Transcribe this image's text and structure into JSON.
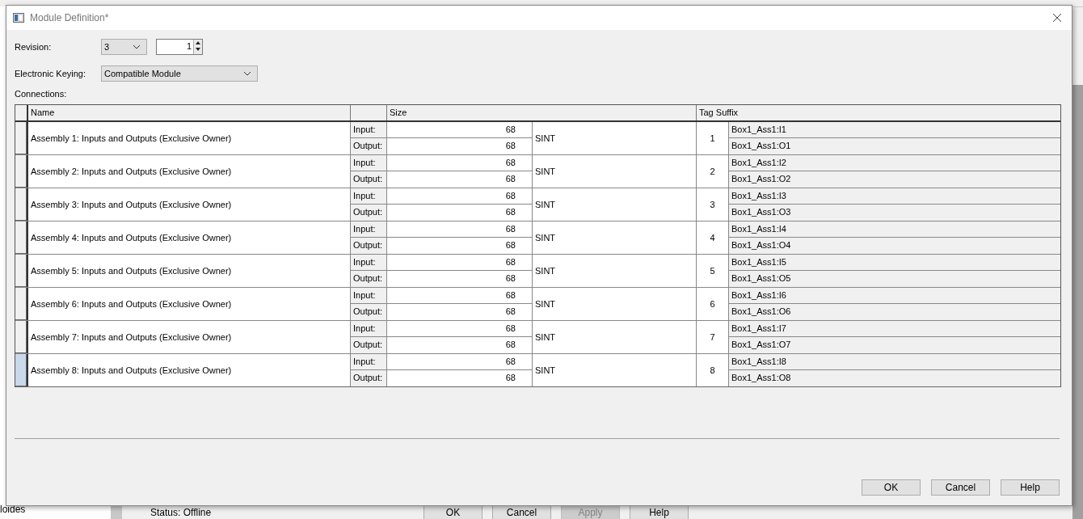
{
  "background": {
    "left_text": "loides",
    "status": "Status:  Offline",
    "buttons": [
      {
        "label": "OK",
        "disabled": false
      },
      {
        "label": "Cancel",
        "disabled": false
      },
      {
        "label": "Apply",
        "disabled": true
      },
      {
        "label": "Help",
        "disabled": false
      }
    ]
  },
  "window": {
    "title": "Module Definition*"
  },
  "revision": {
    "label": "Revision:",
    "major": "3",
    "minor": "1"
  },
  "keying": {
    "label": "Electronic Keying:",
    "value": "Compatible Module"
  },
  "connections_label": "Connections:",
  "table": {
    "columns": [
      "Name",
      "Size",
      "Tag Suffix"
    ],
    "rows": [
      {
        "name": "Assembly 1: Inputs and Outputs (Exclusive Owner)",
        "selected": false,
        "input_label": "Input:",
        "input_size": "68",
        "output_label": "Output:",
        "output_size": "68",
        "type": "SINT",
        "number": "1",
        "input_tag": "Box1_Ass1:I1",
        "output_tag": "Box1_Ass1:O1"
      },
      {
        "name": "Assembly 2: Inputs and Outputs (Exclusive Owner)",
        "selected": false,
        "input_label": "Input:",
        "input_size": "68",
        "output_label": "Output:",
        "output_size": "68",
        "type": "SINT",
        "number": "2",
        "input_tag": "Box1_Ass1:I2",
        "output_tag": "Box1_Ass1:O2"
      },
      {
        "name": "Assembly 3: Inputs and Outputs (Exclusive Owner)",
        "selected": false,
        "input_label": "Input:",
        "input_size": "68",
        "output_label": "Output:",
        "output_size": "68",
        "type": "SINT",
        "number": "3",
        "input_tag": "Box1_Ass1:I3",
        "output_tag": "Box1_Ass1:O3"
      },
      {
        "name": "Assembly 4: Inputs and Outputs (Exclusive Owner)",
        "selected": false,
        "input_label": "Input:",
        "input_size": "68",
        "output_label": "Output:",
        "output_size": "68",
        "type": "SINT",
        "number": "4",
        "input_tag": "Box1_Ass1:I4",
        "output_tag": "Box1_Ass1:O4"
      },
      {
        "name": "Assembly 5: Inputs and Outputs (Exclusive Owner)",
        "selected": false,
        "input_label": "Input:",
        "input_size": "68",
        "output_label": "Output:",
        "output_size": "68",
        "type": "SINT",
        "number": "5",
        "input_tag": "Box1_Ass1:I5",
        "output_tag": "Box1_Ass1:O5"
      },
      {
        "name": "Assembly 6: Inputs and Outputs (Exclusive Owner)",
        "selected": false,
        "input_label": "Input:",
        "input_size": "68",
        "output_label": "Output:",
        "output_size": "68",
        "type": "SINT",
        "number": "6",
        "input_tag": "Box1_Ass1:I6",
        "output_tag": "Box1_Ass1:O6"
      },
      {
        "name": "Assembly 7: Inputs and Outputs (Exclusive Owner)",
        "selected": false,
        "input_label": "Input:",
        "input_size": "68",
        "output_label": "Output:",
        "output_size": "68",
        "type": "SINT",
        "number": "7",
        "input_tag": "Box1_Ass1:I7",
        "output_tag": "Box1_Ass1:O7"
      },
      {
        "name": "Assembly 8: Inputs and Outputs (Exclusive Owner)",
        "selected": true,
        "input_label": "Input:",
        "input_size": "68",
        "output_label": "Output:",
        "output_size": "68",
        "type": "SINT",
        "number": "8",
        "input_tag": "Box1_Ass1:I8",
        "output_tag": "Box1_Ass1:O8"
      }
    ]
  },
  "buttons": [
    {
      "label": "OK"
    },
    {
      "label": "Cancel"
    },
    {
      "label": "Help"
    }
  ]
}
